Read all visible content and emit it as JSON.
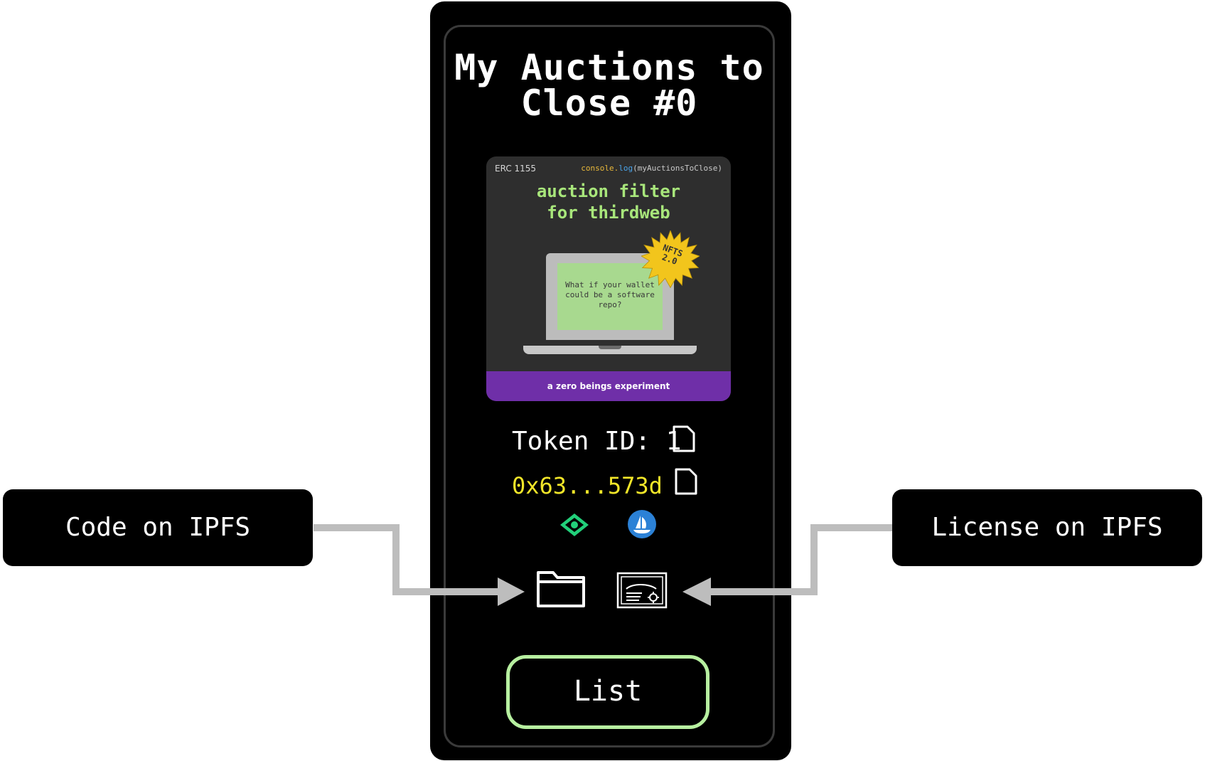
{
  "panel": {
    "title_line1": "My Auctions to",
    "title_line2": "Close #0"
  },
  "card": {
    "standard": "ERC 1155",
    "console_part1": "console.",
    "console_part2": "log",
    "console_part3": "(myAuctionsToClose)",
    "headline_line1": "auction filter",
    "headline_line2": "for thirdweb",
    "badge_line1": "NFTS",
    "badge_line2": "2.0",
    "laptop_text": "What if your wallet could be a software repo?",
    "footer": "a zero beings experiment"
  },
  "token": {
    "id_label": "Token ID: 1",
    "address": "0x63...573d"
  },
  "icons": {
    "copy_id": "document-icon",
    "copy_address": "document-icon",
    "explorer": "eye-icon",
    "opensea": "opensea-icon",
    "code": "folder-icon",
    "license": "certificate-icon"
  },
  "actions": {
    "list_label": "List"
  },
  "callouts": {
    "left": "Code on IPFS",
    "right": "License on IPFS"
  },
  "colors": {
    "accent_green": "#b7f0a0",
    "address_yellow": "#f2e629",
    "footer_purple": "#6f2fa8",
    "headline_green": "#a8e67b"
  }
}
